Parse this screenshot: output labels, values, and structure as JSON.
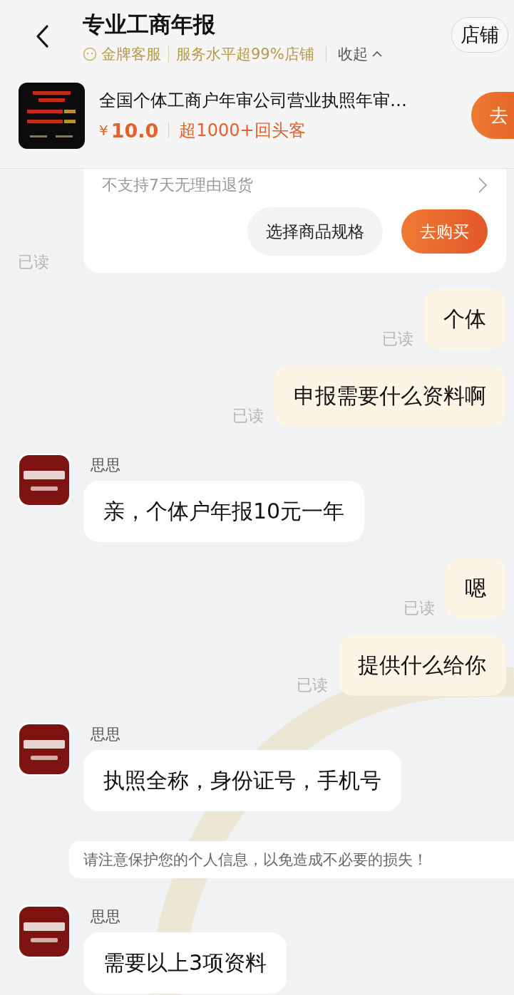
{
  "header": {
    "title": "专业工商年报",
    "badge": "金牌客服",
    "service": "服务水平超99%店铺",
    "collapse": "收起",
    "store_button": "店铺"
  },
  "product": {
    "title": "全国个体工商户年审公司营业执照年审…",
    "currency": "¥",
    "amount": "10.0",
    "repeat": "超1000+回头客",
    "buy": "去"
  },
  "card": {
    "policy": "不支持7天无理由退货",
    "spec_button": "选择商品规格",
    "buy_button": "去购买",
    "read": "已读"
  },
  "messages": [
    {
      "kind": "out",
      "text": "个体",
      "read": "已读"
    },
    {
      "kind": "out",
      "text": "申报需要什么资料啊",
      "read": "已读"
    },
    {
      "kind": "in",
      "sender": "思思",
      "text": "亲，个体户年报10元一年"
    },
    {
      "kind": "out",
      "text": "嗯",
      "read": "已读"
    },
    {
      "kind": "out",
      "text": "提供什么给你",
      "read": "已读"
    },
    {
      "kind": "in",
      "sender": "思思",
      "text": "执照全称，身份证号，手机号"
    },
    {
      "kind": "notice",
      "text": "请注意保护您的个人信息，以免造成不必要的损失！"
    },
    {
      "kind": "in",
      "sender": "思思",
      "text": "需要以上3项资料"
    }
  ]
}
